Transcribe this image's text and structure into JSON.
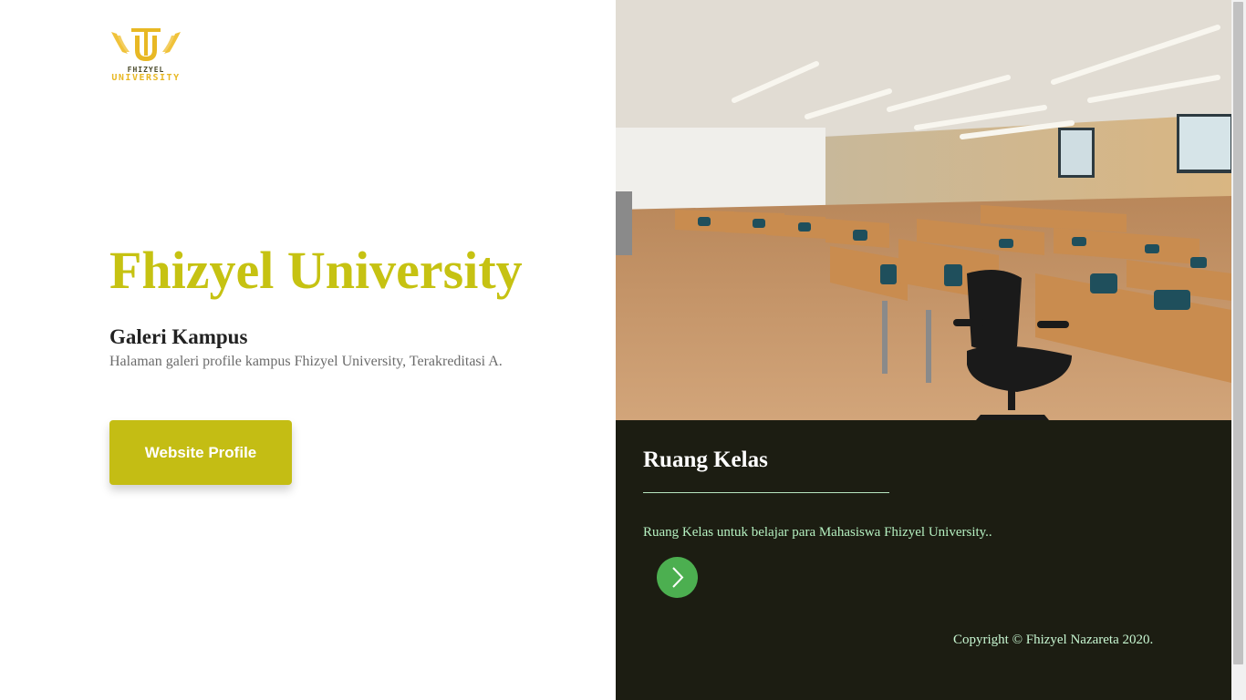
{
  "logo": {
    "line1": "FHIZYEL",
    "line2": "UNIVERSITY"
  },
  "hero": {
    "title": "Fhizyel University",
    "subtitle": "Galeri Kampus",
    "description": "Halaman galeri profile kampus Fhizyel University, Terakreditasi A.",
    "button_label": "Website Profile"
  },
  "card": {
    "title": "Ruang Kelas",
    "text": "Ruang Kelas untuk belajar para Mahasiswa Fhizyel University..",
    "next_icon": "chevron-right-icon"
  },
  "footer": {
    "copyright": "Copyright © Fhizyel Nazareta 2020."
  },
  "colors": {
    "accent": "#c4bd14",
    "panel": "#1c1d12",
    "arrow": "#4caf50",
    "logo_gold": "#e8b824"
  }
}
